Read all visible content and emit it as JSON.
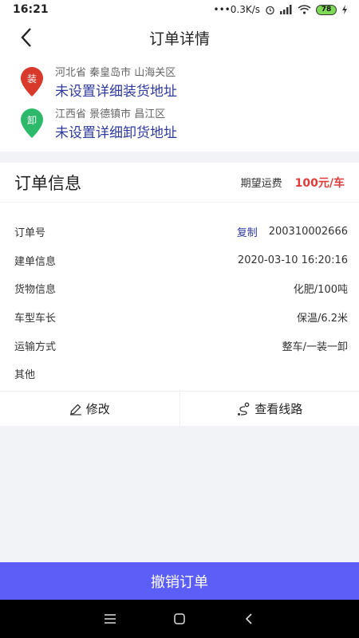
{
  "status_bar": {
    "time": "16:21",
    "network_speed": "•••0.3K/s",
    "battery": "78"
  },
  "header": {
    "title": "订单详情",
    "back_icon": "chevron-left-icon"
  },
  "addresses": {
    "load": {
      "badge": "装",
      "region": "河北省 秦皇岛市 山海关区",
      "detail": "未设置详细装货地址",
      "color": "#d8392b"
    },
    "unload": {
      "badge": "卸",
      "region": "江西省 景德镇市 昌江区",
      "detail": "未设置详细卸货地址",
      "color": "#2cba6a"
    }
  },
  "order_info": {
    "title": "订单信息",
    "fee_label": "期望运费",
    "fee_value": "100元/车",
    "rows": [
      {
        "label": "订单号",
        "action": "复制",
        "value": "200310002666"
      },
      {
        "label": "建单信息",
        "value": "2020-03-10 16:20:16"
      },
      {
        "label": "货物信息",
        "value": "化肥/100吨"
      },
      {
        "label": "车型车长",
        "value": "保温/6.2米"
      },
      {
        "label": "运输方式",
        "value": "整车/一装一卸"
      },
      {
        "label": "其他",
        "value": ""
      }
    ]
  },
  "actions": {
    "edit_label": "修改",
    "route_label": "查看线路"
  },
  "cancel_button": "撤销订单",
  "colors": {
    "accent": "#5b5ef7",
    "link": "#2f3a9e",
    "price": "#e23b3b"
  }
}
